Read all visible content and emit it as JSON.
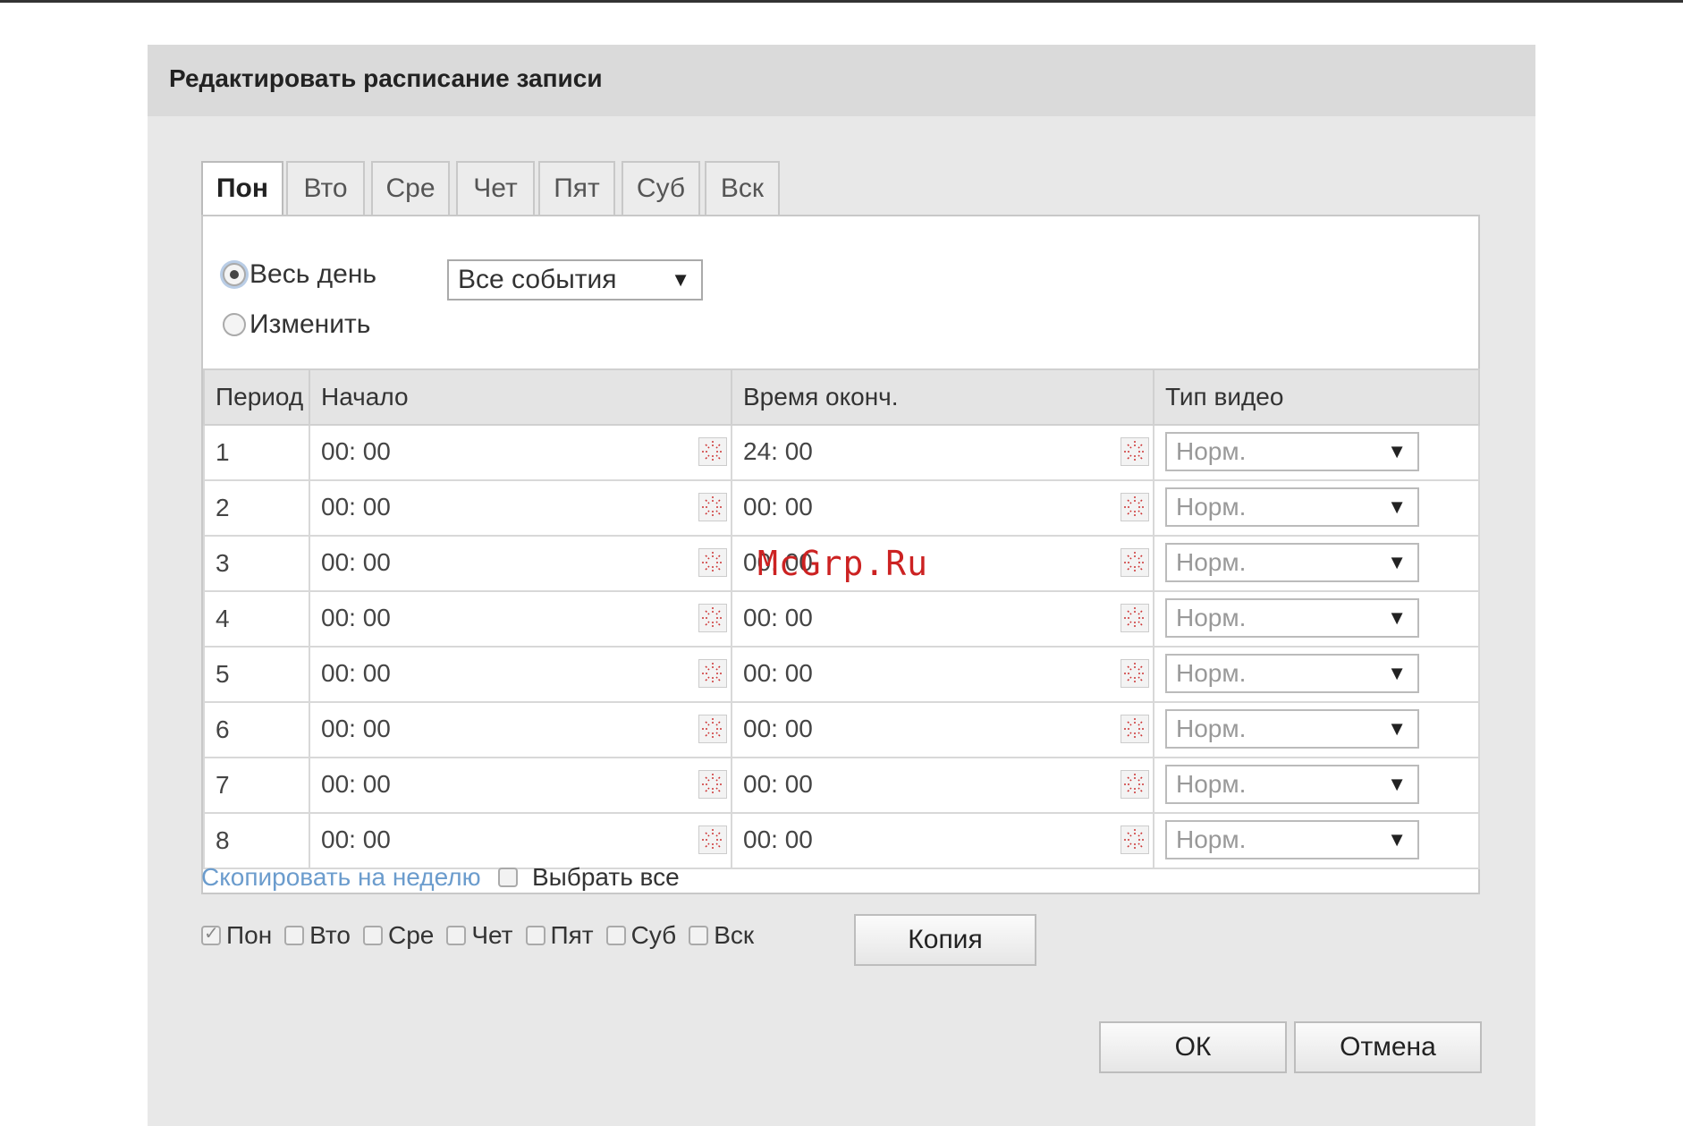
{
  "dialog": {
    "title": "Редактировать расписание записи"
  },
  "tabs": [
    {
      "label": "Пон",
      "active": true
    },
    {
      "label": "Вто",
      "active": false
    },
    {
      "label": "Сре",
      "active": false
    },
    {
      "label": "Чет",
      "active": false
    },
    {
      "label": "Пят",
      "active": false
    },
    {
      "label": "Суб",
      "active": false
    },
    {
      "label": "Вск",
      "active": false
    }
  ],
  "mode": {
    "all_day_label": "Весь день",
    "all_day_selected": true,
    "edit_label": "Изменить",
    "edit_selected": false,
    "event_select_value": "Все события"
  },
  "table": {
    "headers": {
      "period": "Период",
      "start": "Начало",
      "end": "Время оконч.",
      "video_type": "Тип видео"
    },
    "rows": [
      {
        "period": "1",
        "start": "00: 00",
        "end": "24: 00",
        "type": "Норм."
      },
      {
        "period": "2",
        "start": "00: 00",
        "end": "00: 00",
        "type": "Норм."
      },
      {
        "period": "3",
        "start": "00: 00",
        "end": "00: 00",
        "type": "Норм."
      },
      {
        "period": "4",
        "start": "00: 00",
        "end": "00: 00",
        "type": "Норм."
      },
      {
        "period": "5",
        "start": "00: 00",
        "end": "00: 00",
        "type": "Норм."
      },
      {
        "period": "6",
        "start": "00: 00",
        "end": "00: 00",
        "type": "Норм."
      },
      {
        "period": "7",
        "start": "00: 00",
        "end": "00: 00",
        "type": "Норм."
      },
      {
        "period": "8",
        "start": "00: 00",
        "end": "00: 00",
        "type": "Норм."
      }
    ]
  },
  "copy": {
    "link_label": "Скопировать на неделю",
    "select_all_label": "Выбрать все",
    "select_all_checked": false,
    "days": [
      {
        "label": "Пон",
        "checked": true
      },
      {
        "label": "Вто",
        "checked": false
      },
      {
        "label": "Сре",
        "checked": false
      },
      {
        "label": "Чет",
        "checked": false
      },
      {
        "label": "Пят",
        "checked": false
      },
      {
        "label": "Суб",
        "checked": false
      },
      {
        "label": "Вск",
        "checked": false
      }
    ],
    "copy_button_label": "Копия"
  },
  "footer": {
    "ok_label": "ОК",
    "cancel_label": "Отмена"
  },
  "watermark": "McGrp.Ru",
  "colors": {
    "link": "#6b9ccd",
    "watermark": "#cc2222",
    "header_bg": "#dadada",
    "dialog_bg": "#e8e8e8"
  }
}
